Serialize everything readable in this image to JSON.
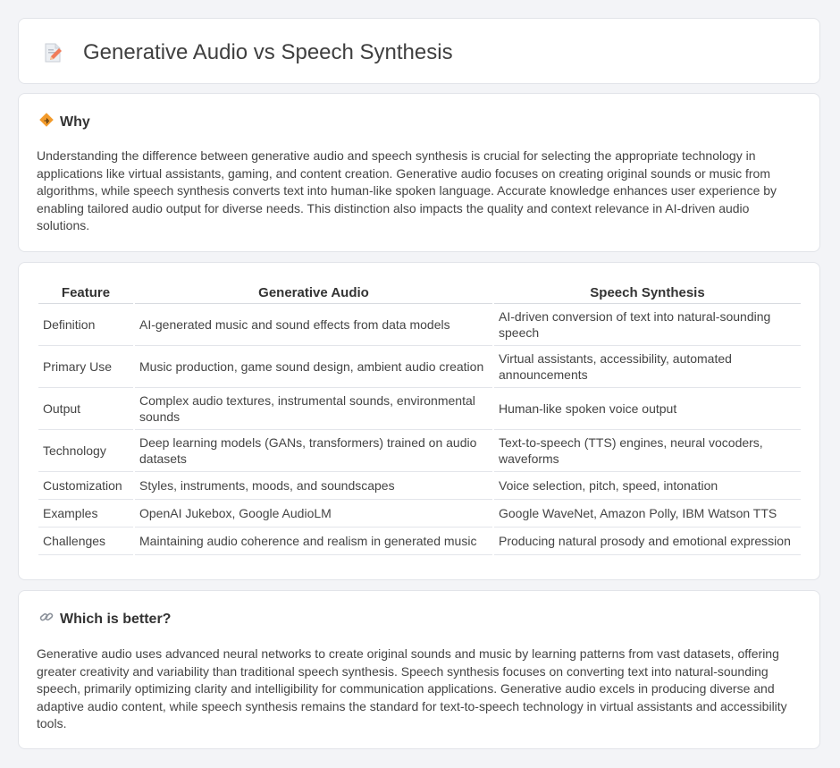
{
  "header": {
    "title": "Generative Audio vs Speech Synthesis",
    "icon": "document-edit-icon"
  },
  "why": {
    "heading": "Why",
    "icon": "diamond-sign-icon",
    "text": "Understanding the difference between generative audio and speech synthesis is crucial for selecting the appropriate technology in applications like virtual assistants, gaming, and content creation. Generative audio focuses on creating original sounds or music from algorithms, while speech synthesis converts text into human-like spoken language. Accurate knowledge enhances user experience by enabling tailored audio output for diverse needs. This distinction also impacts the quality and context relevance in AI-driven audio solutions."
  },
  "table": {
    "headers": [
      "Feature",
      "Generative Audio",
      "Speech Synthesis"
    ],
    "rows": [
      [
        "Definition",
        "AI-generated music and sound effects from data models",
        "AI-driven conversion of text into natural-sounding speech"
      ],
      [
        "Primary Use",
        "Music production, game sound design, ambient audio creation",
        "Virtual assistants, accessibility, automated announcements"
      ],
      [
        "Output",
        "Complex audio textures, instrumental sounds, environmental sounds",
        "Human-like spoken voice output"
      ],
      [
        "Technology",
        "Deep learning models (GANs, transformers) trained on audio datasets",
        "Text-to-speech (TTS) engines, neural vocoders, waveforms"
      ],
      [
        "Customization",
        "Styles, instruments, moods, and soundscapes",
        "Voice selection, pitch, speed, intonation"
      ],
      [
        "Examples",
        "OpenAI Jukebox, Google AudioLM",
        "Google WaveNet, Amazon Polly, IBM Watson TTS"
      ],
      [
        "Challenges",
        "Maintaining audio coherence and realism in generated music",
        "Producing natural prosody and emotional expression"
      ]
    ]
  },
  "better": {
    "heading": "Which is better?",
    "icon": "link-icon",
    "text": "Generative audio uses advanced neural networks to create original sounds and music by learning patterns from vast datasets, offering greater creativity and variability than traditional speech synthesis. Speech synthesis focuses on converting text into natural-sounding speech, primarily optimizing clarity and intelligibility for communication applications. Generative audio excels in producing diverse and adaptive audio content, while speech synthesis remains the standard for text-to-speech technology in virtual assistants and accessibility tools."
  },
  "colors": {
    "background": "#f3f4f7",
    "card": "#ffffff",
    "border": "#e2e4e9",
    "accent_orange": "#f29b2c"
  }
}
